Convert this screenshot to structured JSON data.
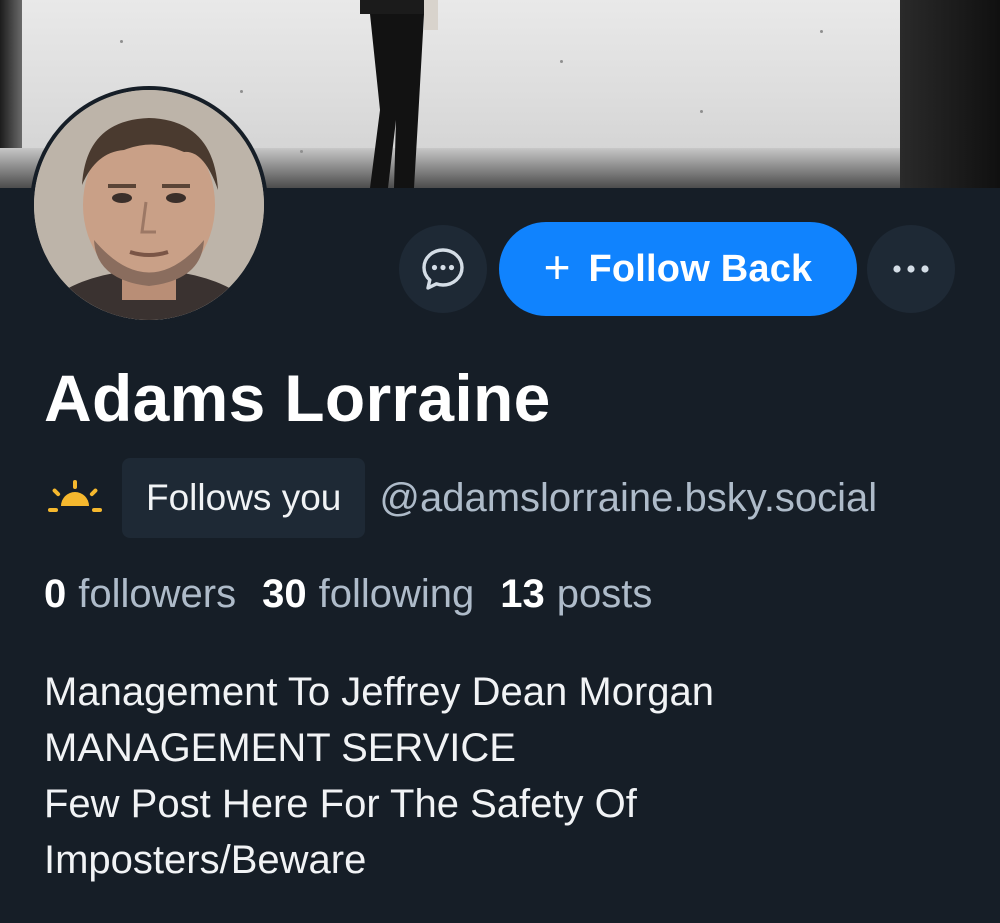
{
  "profile": {
    "display_name": "Adams Lorraine",
    "handle": "@adamslorraine.bsky.social",
    "follows_you_label": "Follows you",
    "bio_lines": [
      "Management To Jeffrey Dean Morgan",
      "MANAGEMENT SERVICE",
      "Few Post Here For The Safety Of",
      "Imposters/Beware"
    ]
  },
  "stats": {
    "followers_count": "0",
    "followers_label": "followers",
    "following_count": "30",
    "following_label": "following",
    "posts_count": "13",
    "posts_label": "posts"
  },
  "actions": {
    "follow_back_label": "Follow Back",
    "follow_plus": "+"
  },
  "icons": {
    "message": "chat-bubble-icon",
    "more": "ellipsis-icon",
    "status": "sunrise-icon",
    "add": "plus-icon"
  },
  "colors": {
    "background": "#161e27",
    "button_primary": "#1083fe",
    "button_secondary": "#1e2935",
    "muted_text": "#aebbc9",
    "sun": "#f5b82e"
  }
}
